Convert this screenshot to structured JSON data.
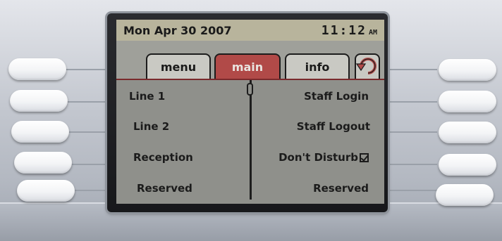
{
  "status_bar": {
    "date": "Mon Apr 30 2007",
    "time": "11:12",
    "ampm": "AM"
  },
  "tabs": [
    {
      "label": "menu",
      "active": false
    },
    {
      "label": "main",
      "active": true
    },
    {
      "label": "info",
      "active": false
    }
  ],
  "left_lines": [
    "Line 1",
    "Line 2",
    "Reception",
    "Reserved"
  ],
  "right_lines": [
    "Staff Login",
    "Staff Logout",
    "Don't Disturb",
    "Reserved"
  ],
  "colors": {
    "active_tab": "#b14a48",
    "lcd_background": "#9a9b95",
    "status_bar": "#b8b49c"
  },
  "icons": {
    "back": "back-arrow-icon",
    "dnd_state": "checkbox-checked-icon"
  }
}
